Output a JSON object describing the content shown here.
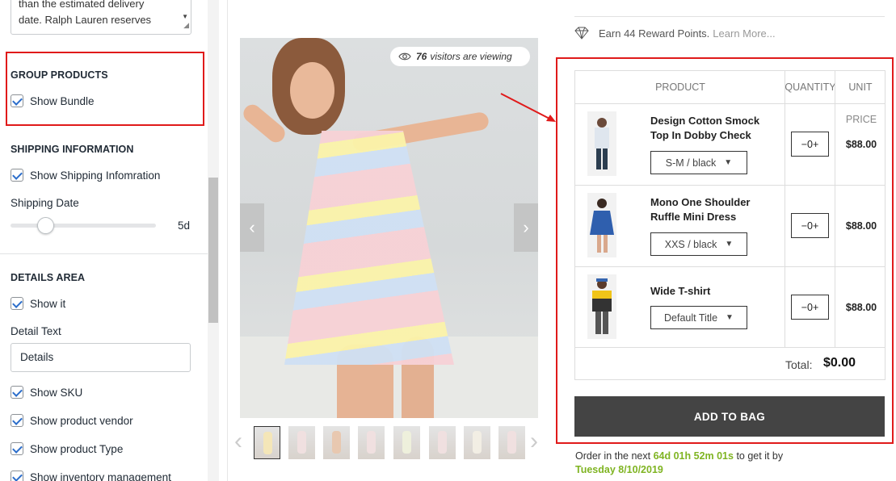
{
  "sidebar": {
    "textarea_lines": [
      "than the estimated delivery",
      "date. Ralph Lauren reserves"
    ],
    "group_products": {
      "title": "GROUP PRODUCTS",
      "show_bundle": "Show Bundle"
    },
    "shipping": {
      "title": "SHIPPING INFORMATION",
      "show_shipping": "Show Shipping Infomration",
      "date_label": "Shipping Date",
      "date_value": "5d"
    },
    "details": {
      "title": "DETAILS AREA",
      "show_it": "Show it",
      "detail_text_label": "Detail Text",
      "detail_text_value": "Details",
      "show_sku": "Show SKU",
      "show_vendor": "Show product vendor",
      "show_type": "Show product Type",
      "show_inventory": "Show inventory management"
    }
  },
  "gallery": {
    "visitors_count": "76",
    "visitors_text": "visitors are viewing",
    "prev_icon": "chevron-left-icon",
    "next_icon": "chevron-right-icon"
  },
  "reward": {
    "text": "Earn 44 Reward Points.",
    "link": "Learn More..."
  },
  "bundle": {
    "headers": {
      "product": "PRODUCT",
      "quantity": "QUANTITY",
      "unit": "UNIT"
    },
    "price_label": "PRICE",
    "items": [
      {
        "name": "Design Cotton Smock Top In Dobby Check",
        "variant": "S-M / black",
        "qty": "−0+",
        "price": "$88.00"
      },
      {
        "name": "Mono One Shoulder Ruffle Mini Dress",
        "variant": "XXS / black",
        "qty": "−0+",
        "price": "$88.00"
      },
      {
        "name": "Wide T-shirt",
        "variant": "Default Title",
        "qty": "−0+",
        "price": "$88.00"
      }
    ],
    "total_label": "Total:",
    "total_value": "$0.00",
    "add_button": "ADD TO BAG"
  },
  "order": {
    "prefix": "Order in the next",
    "countdown": "64d 01h 52m 01s",
    "suffix": "to get it by",
    "date": "Tuesday 8/10/2019"
  },
  "colors": {
    "highlight": "#e01a1a",
    "accent_green": "#7fb422",
    "button": "#444444",
    "checkbox": "#2c6ecb"
  }
}
